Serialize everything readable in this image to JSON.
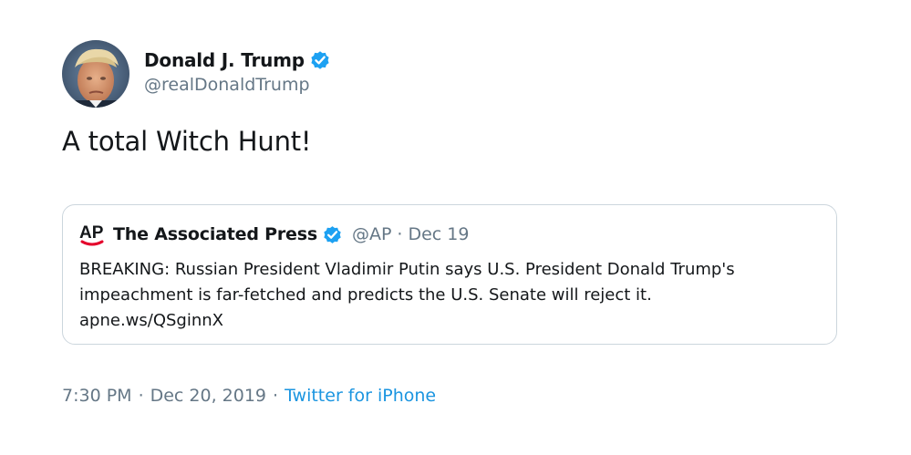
{
  "tweet": {
    "author": {
      "display_name": "Donald J. Trump",
      "handle": "@realDonaldTrump",
      "avatar_icon": "profile-photo",
      "verified": true
    },
    "text": "A total Witch Hunt!",
    "quoted_tweet": {
      "logo_icon": "ap-logo",
      "display_name": "The Associated Press",
      "verified": true,
      "handle": "@AP",
      "separator": "·",
      "date": "Dec 19",
      "body_lines": [
        "BREAKING: Russian President Vladimir Putin says U.S. President Donald Trump's",
        "impeachment is far-fetched and predicts the U.S. Senate will reject it.",
        "apne.ws/QSginnX"
      ]
    },
    "meta": {
      "time": "7:30 PM",
      "separator": "·",
      "date": "Dec 20, 2019",
      "source": "Twitter for iPhone"
    }
  },
  "colors": {
    "text_primary": "#14171a",
    "text_secondary": "#657786",
    "link_blue": "#1b95e0",
    "verified_blue": "#1da1f2",
    "border": "#ccd6dd",
    "ap_red": "#e4002b"
  }
}
